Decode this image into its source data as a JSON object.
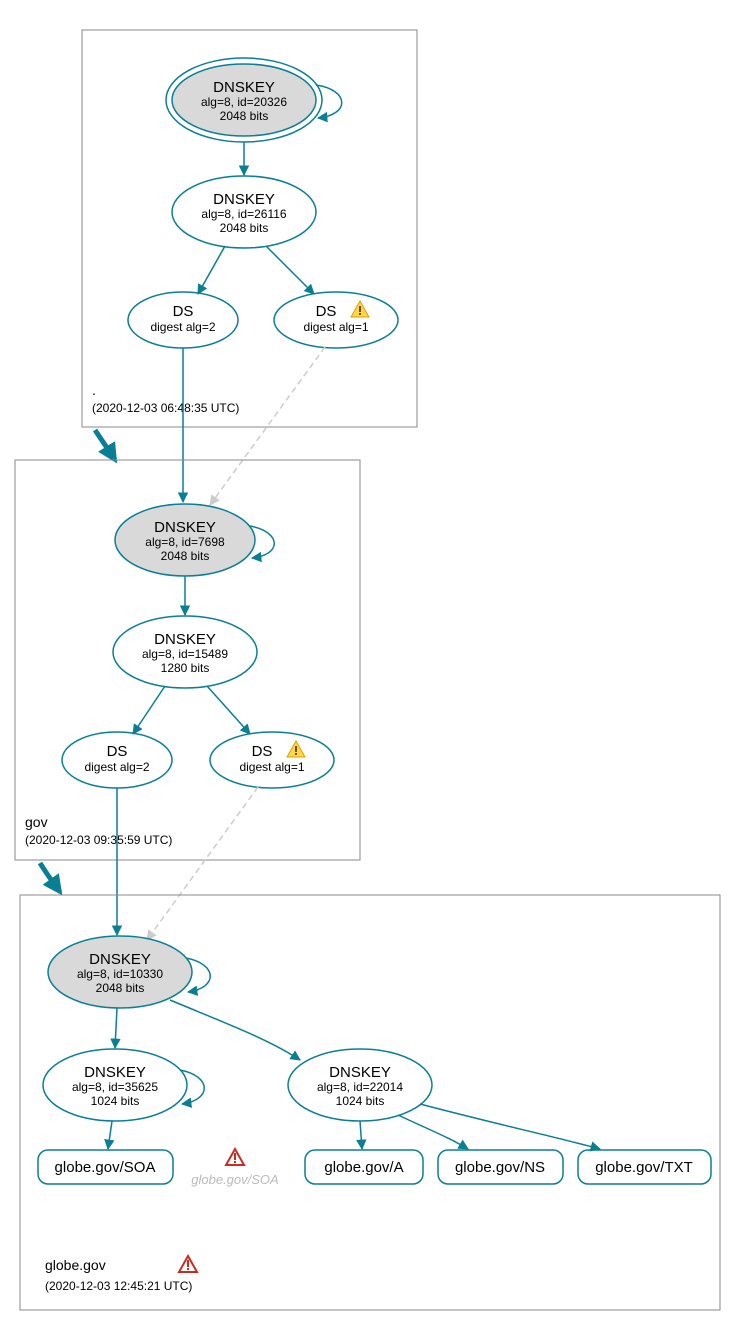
{
  "colors": {
    "secure": "#0a7f94",
    "insecure": "#cccccc",
    "ksk_fill": "#d9d9d9"
  },
  "icons": {
    "warn_yellow": "warning-icon",
    "warn_red": "error-icon"
  },
  "zones": {
    "root": {
      "label": ".",
      "timestamp": "(2020-12-03 06:48:35 UTC)",
      "nodes": {
        "ksk": {
          "title": "DNSKEY",
          "line2": "alg=8, id=20326",
          "line3": "2048 bits"
        },
        "zsk": {
          "title": "DNSKEY",
          "line2": "alg=8, id=26116",
          "line3": "2048 bits"
        },
        "ds1": {
          "title": "DS",
          "line2": "digest alg=2"
        },
        "ds2": {
          "title": "DS",
          "line2": "digest alg=1",
          "warn": true
        }
      }
    },
    "gov": {
      "label": "gov",
      "timestamp": "(2020-12-03 09:35:59 UTC)",
      "nodes": {
        "ksk": {
          "title": "DNSKEY",
          "line2": "alg=8, id=7698",
          "line3": "2048 bits"
        },
        "zsk": {
          "title": "DNSKEY",
          "line2": "alg=8, id=15489",
          "line3": "1280 bits"
        },
        "ds1": {
          "title": "DS",
          "line2": "digest alg=2"
        },
        "ds2": {
          "title": "DS",
          "line2": "digest alg=1",
          "warn": true
        }
      }
    },
    "globe": {
      "label": "globe.gov",
      "timestamp": "(2020-12-03 12:45:21 UTC)",
      "error": true,
      "nodes": {
        "ksk": {
          "title": "DNSKEY",
          "line2": "alg=8, id=10330",
          "line3": "2048 bits"
        },
        "zsk1": {
          "title": "DNSKEY",
          "line2": "alg=8, id=35625",
          "line3": "1024 bits"
        },
        "zsk2": {
          "title": "DNSKEY",
          "line2": "alg=8, id=22014",
          "line3": "1024 bits"
        }
      },
      "rrsets": {
        "soa": "globe.gov/SOA",
        "soa_bogus": "globe.gov/SOA",
        "a": "globe.gov/A",
        "ns": "globe.gov/NS",
        "txt": "globe.gov/TXT"
      }
    }
  }
}
